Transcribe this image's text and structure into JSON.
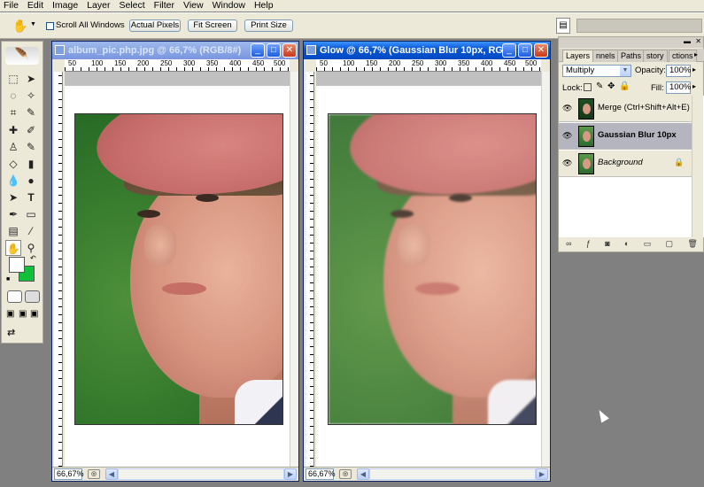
{
  "menu": [
    "File",
    "Edit",
    "Image",
    "Layer",
    "Select",
    "Filter",
    "View",
    "Window",
    "Help"
  ],
  "options": {
    "scroll_all_windows": "Scroll All Windows",
    "actual_pixels": "Actual Pixels",
    "fit_screen": "Fit Screen",
    "print_size": "Print Size"
  },
  "doc1": {
    "title": "album_pic.php.jpg @ 66,7% (RGB/8#)",
    "zoom": "66,67%",
    "ruler": [
      "50",
      "100",
      "150",
      "200",
      "250",
      "300",
      "350",
      "400",
      "450",
      "500"
    ]
  },
  "doc2": {
    "title": "Glow @ 66,7% (Gaussian Blur 10px, RG...",
    "zoom": "66,67%",
    "ruler": [
      "50",
      "100",
      "150",
      "200",
      "250",
      "300",
      "350",
      "400",
      "450",
      "500"
    ]
  },
  "layers_panel": {
    "tabs": [
      "Layers",
      "nnels",
      "Paths",
      "story",
      "ctions"
    ],
    "blend_mode": "Multiply",
    "opacity_label": "Opacity:",
    "opacity": "100%",
    "lock_label": "Lock:",
    "fill_label": "Fill:",
    "fill": "100%",
    "layers": [
      {
        "name": "Merge (Ctrl+Shift+Alt+E)",
        "selected": false
      },
      {
        "name": "Gaussian Blur 10px",
        "selected": true
      },
      {
        "name": "Background",
        "selected": false
      }
    ]
  }
}
